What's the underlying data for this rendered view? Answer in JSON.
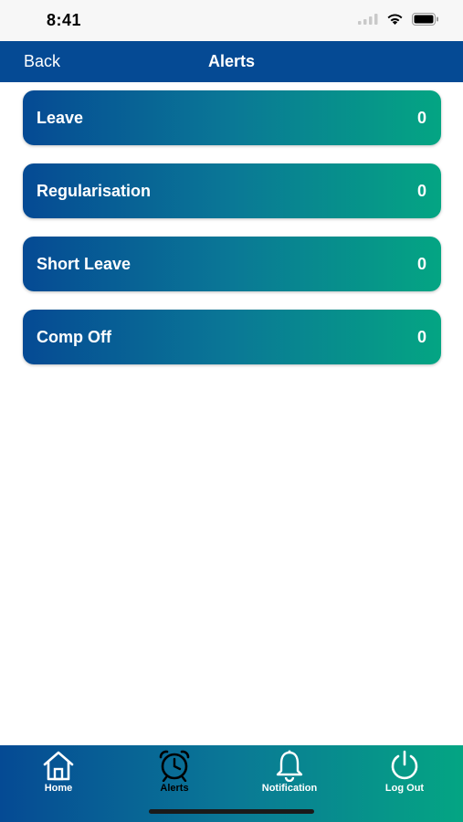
{
  "status_bar": {
    "time": "8:41"
  },
  "nav": {
    "back_label": "Back",
    "title": "Alerts"
  },
  "alerts": [
    {
      "label": "Leave",
      "count": "0"
    },
    {
      "label": "Regularisation",
      "count": "0"
    },
    {
      "label": "Short Leave",
      "count": "0"
    },
    {
      "label": "Comp Off",
      "count": "0"
    }
  ],
  "tab_bar": {
    "items": [
      {
        "label": "Home",
        "icon": "home-icon",
        "active": false
      },
      {
        "label": "Alerts",
        "icon": "alarm-clock-icon",
        "active": true
      },
      {
        "label": "Notification",
        "icon": "bell-icon",
        "active": false
      },
      {
        "label": "Log Out",
        "icon": "power-icon",
        "active": false
      }
    ]
  },
  "colors": {
    "nav_background": "#054a94",
    "gradient_start": "#054a94",
    "gradient_end": "#04a583",
    "text": "#ffffff"
  }
}
